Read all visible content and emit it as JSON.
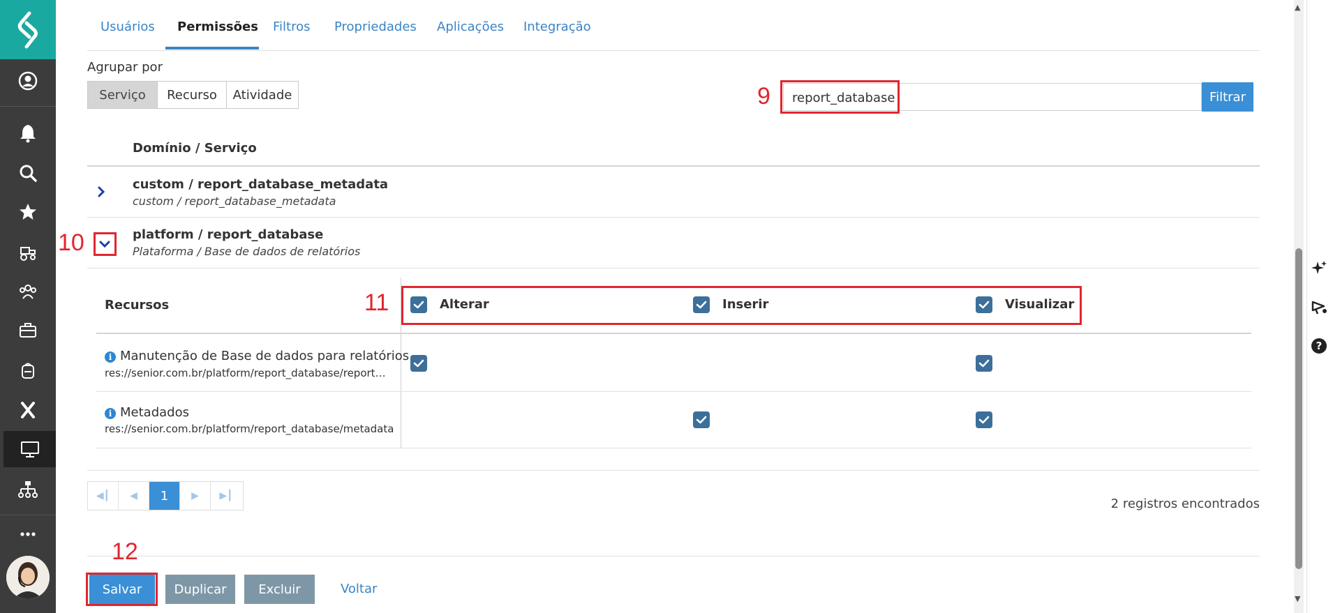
{
  "tabs": [
    {
      "label": "Usuários"
    },
    {
      "label": "Permissões"
    },
    {
      "label": "Filtros"
    },
    {
      "label": "Propriedades"
    },
    {
      "label": "Aplicações"
    },
    {
      "label": "Integração"
    }
  ],
  "group_by": {
    "label": "Agrupar por",
    "options": [
      "Serviço",
      "Recurso",
      "Atividade"
    ],
    "selected": "Serviço"
  },
  "filter": {
    "value": "report_database",
    "button_label": "Filtrar"
  },
  "table": {
    "column_header": "Domínio / Serviço",
    "rows": [
      {
        "title": "custom / report_database_metadata",
        "subtitle": "custom / report_database_metadata",
        "expanded": false
      },
      {
        "title": "platform / report_database",
        "subtitle": "Plataforma / Base de dados de relatórios",
        "expanded": true
      }
    ]
  },
  "permissions": {
    "resources_header": "Recursos",
    "columns": [
      "Alterar",
      "Inserir",
      "Visualizar"
    ],
    "resources": [
      {
        "name": "Manutenção de Base de dados para relatórios",
        "path": "res://senior.com.br/platform/report_database/report_database",
        "alterar": true,
        "inserir": false,
        "visualizar": true
      },
      {
        "name": "Metadados",
        "path": "res://senior.com.br/platform/report_database/metadata",
        "alterar": false,
        "inserir": true,
        "visualizar": true
      }
    ]
  },
  "pagination": {
    "current_page": "1",
    "records_text": "2 registros encontrados"
  },
  "buttons": {
    "save": "Salvar",
    "duplicate": "Duplicar",
    "delete": "Excluir",
    "back": "Voltar"
  },
  "annotations": {
    "step9": "9",
    "step10": "10",
    "step11": "11",
    "step12": "12"
  },
  "colors": {
    "brand_teal": "#1aa9a0",
    "accent_blue": "#3a8fd6",
    "annotation_red": "#e0262e",
    "sidebar_dark": "#3c3c3c",
    "checkbox_blue": "#3c6f9a"
  }
}
